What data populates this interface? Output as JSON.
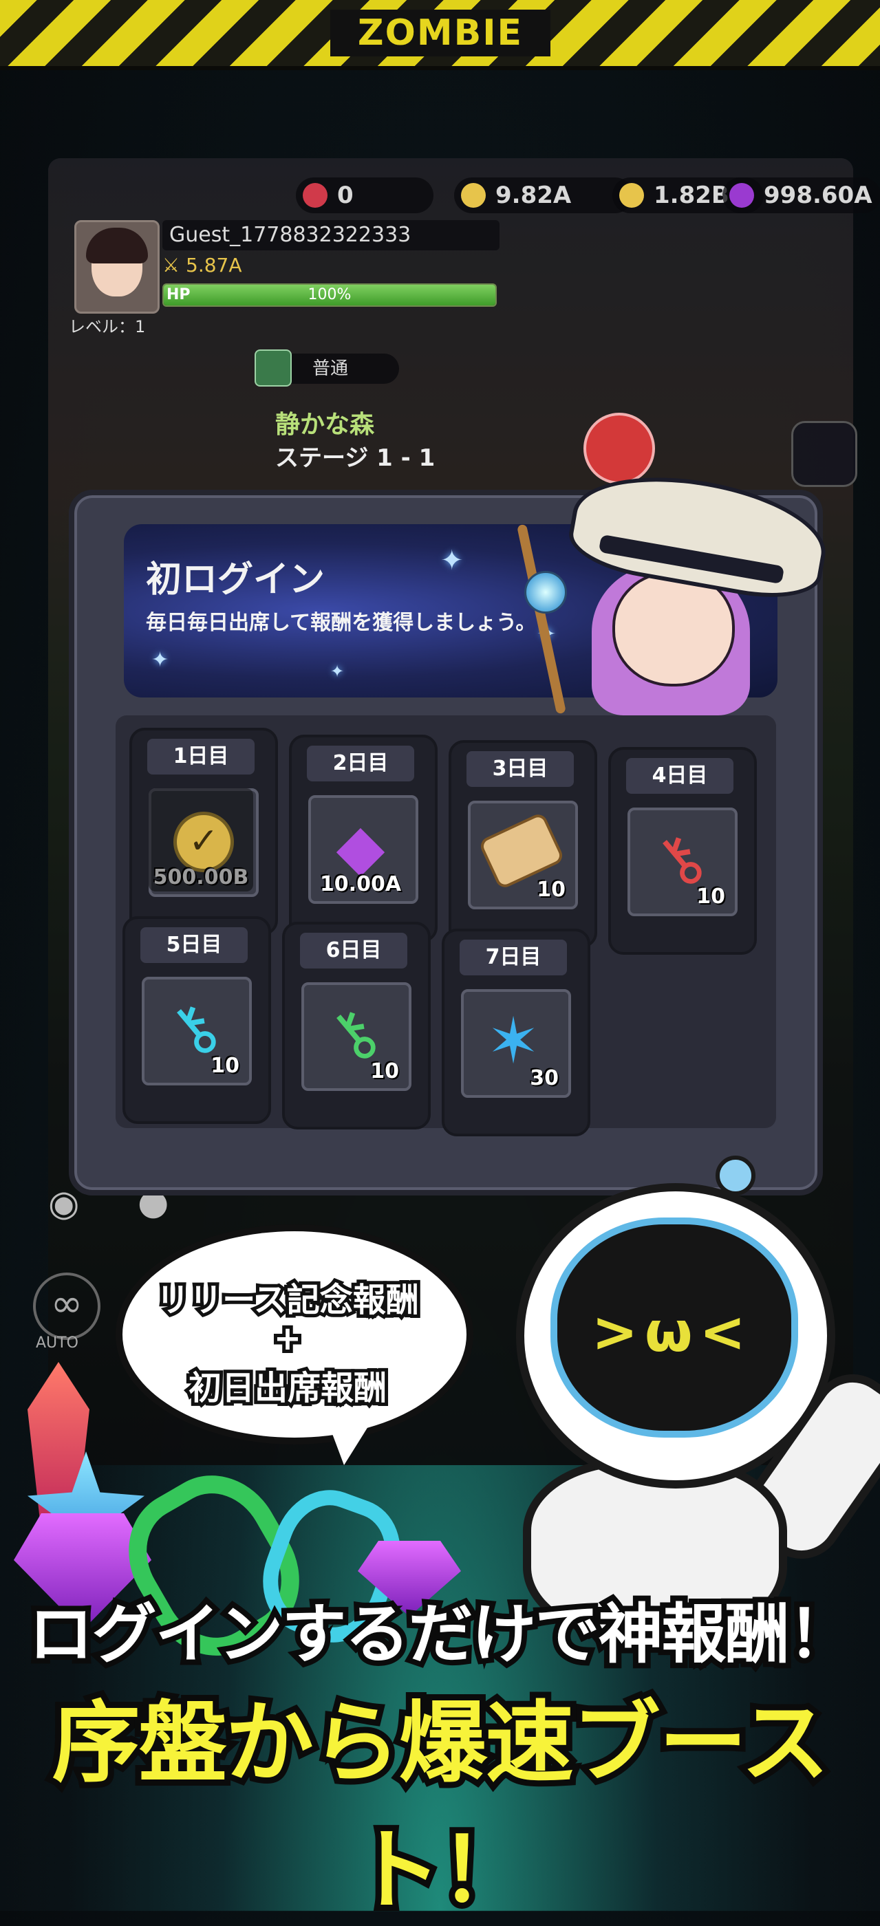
{
  "banner": {
    "label": "ZOMBIE"
  },
  "hud": {
    "values": [
      "0",
      "9.82A",
      "1.82B",
      "998.60A"
    ]
  },
  "profile": {
    "name": "Guest_1778832322333",
    "power": "5.87A",
    "hp_label": "HP",
    "hp_text": "100%",
    "hp_fraction": 1.0,
    "level": "レベル：1"
  },
  "stage": {
    "difficulty": "普通",
    "area": "静かな森",
    "number": "ステージ 1 - 1"
  },
  "login_panel": {
    "title": "初ログイン",
    "subtitle": "毎日毎日出席して報酬を獲得しましょう。",
    "days": [
      {
        "label": "1日目",
        "item_icon": "check-icon",
        "quantity": "500.00B",
        "claimed": true
      },
      {
        "label": "2日目",
        "item_icon": "gem-icon",
        "quantity": "10.00A",
        "claimed": false
      },
      {
        "label": "3日目",
        "item_icon": "scroll-icon",
        "quantity": "10",
        "claimed": false
      },
      {
        "label": "4日目",
        "item_icon": "red-key-icon",
        "quantity": "10",
        "claimed": false
      },
      {
        "label": "5日目",
        "item_icon": "blue-key-icon",
        "quantity": "10",
        "claimed": false
      },
      {
        "label": "6日目",
        "item_icon": "green-key-icon",
        "quantity": "10",
        "claimed": false
      },
      {
        "label": "7日目",
        "item_icon": "blue-star-icon",
        "quantity": "30",
        "claimed": false
      }
    ]
  },
  "speech_bubble": {
    "line1": "リリース記念報酬",
    "line2": "+",
    "line3": "初日出席報酬"
  },
  "side": {
    "auto_label": "AUTO"
  },
  "headline": {
    "line1": "ログインするだけで神報酬！",
    "line2": "序盤から爆速ブースト！"
  },
  "colors": {
    "accent_yellow": "#f7f33a",
    "tape_yellow": "#e0d21a",
    "panel_bg": "#3b3d4c",
    "hp_green": "#3f9c2a"
  }
}
